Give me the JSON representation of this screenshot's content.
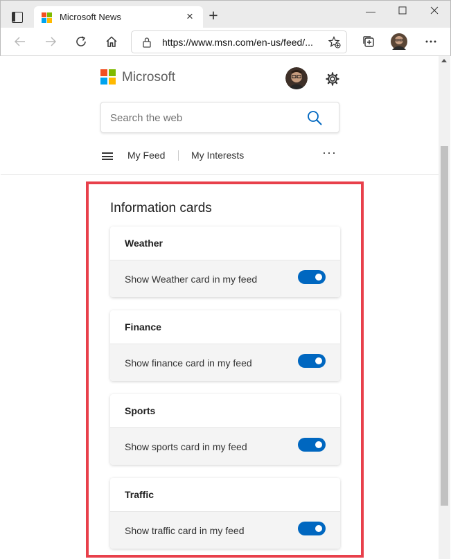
{
  "browser": {
    "tab_title": "Microsoft News",
    "address": "https://www.msn.com/en-us/feed/..."
  },
  "header": {
    "brand": "Microsoft",
    "search_placeholder": "Search the web",
    "nav": {
      "feed": "My Feed",
      "interests": "My Interests",
      "more": "···"
    }
  },
  "section": {
    "title": "Information cards",
    "cards": [
      {
        "title": "Weather",
        "label": "Show Weather card in my feed",
        "enabled": true
      },
      {
        "title": "Finance",
        "label": "Show finance card in my feed",
        "enabled": true
      },
      {
        "title": "Sports",
        "label": "Show sports card in my feed",
        "enabled": true
      },
      {
        "title": "Traffic",
        "label": "Show traffic card in my feed",
        "enabled": true
      }
    ]
  },
  "colors": {
    "accent": "#0067c0",
    "highlight": "#e8404b",
    "logo": [
      "#f25022",
      "#7fba00",
      "#00a4ef",
      "#ffb900"
    ]
  },
  "icons": {
    "tab_actions": "tab-actions-icon",
    "back": "back-arrow-icon",
    "forward": "forward-arrow-icon",
    "refresh": "refresh-icon",
    "home": "home-icon",
    "lock": "lock-icon",
    "favorite": "favorite-add-icon",
    "collections": "collections-icon",
    "settings": "gear-icon",
    "search": "search-icon"
  }
}
